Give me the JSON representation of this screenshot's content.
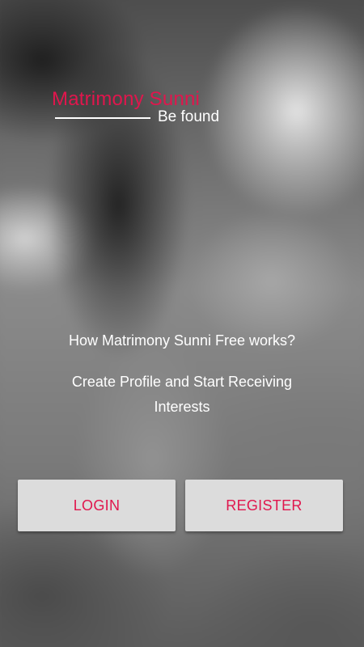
{
  "logo": {
    "title": "Matrimony Sunni",
    "subtitle": "Be found"
  },
  "info": {
    "heading": "How Matrimony Sunni Free works?",
    "tagline": "Create Profile and Start Receiving Interests"
  },
  "actions": {
    "login_label": "LOGIN",
    "register_label": "REGISTER"
  },
  "colors": {
    "accent": "#e0164d",
    "button_bg": "#dcdcdc",
    "text": "#ffffff"
  }
}
